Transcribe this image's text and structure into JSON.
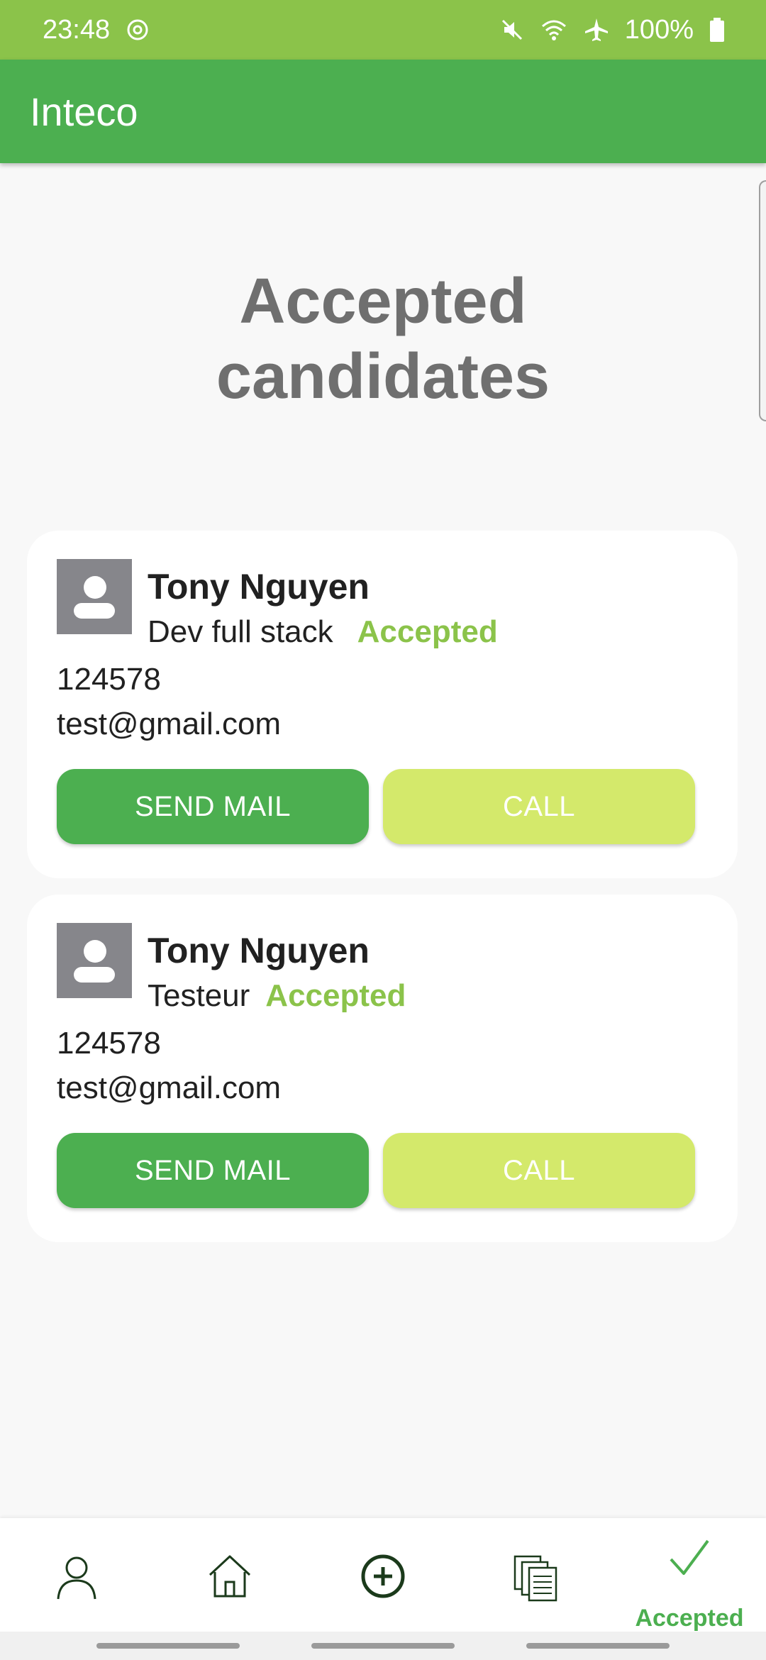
{
  "status_bar": {
    "time": "23:48",
    "battery": "100%",
    "icons": [
      "sync-icon",
      "mute-icon",
      "wifi-icon",
      "airplane-icon",
      "battery-icon"
    ]
  },
  "app_bar": {
    "title": "Inteco"
  },
  "page": {
    "title_line1": "Accepted",
    "title_line2": "candidates"
  },
  "candidates": [
    {
      "name": "Tony Nguyen",
      "role": "Dev full stack",
      "status": "Accepted",
      "phone": "124578",
      "email": "test@gmail.com",
      "mail_label": "SEND MAIL",
      "call_label": "CALL"
    },
    {
      "name": "Tony Nguyen",
      "role": "Testeur",
      "status": "Accepted",
      "phone": "124578",
      "email": "test@gmail.com",
      "mail_label": "SEND MAIL",
      "call_label": "CALL"
    }
  ],
  "bottom_nav": {
    "items": [
      {
        "icon": "person-icon",
        "label": ""
      },
      {
        "icon": "home-icon",
        "label": ""
      },
      {
        "icon": "add-circle-icon",
        "label": ""
      },
      {
        "icon": "documents-icon",
        "label": ""
      },
      {
        "icon": "check-icon",
        "label": "Accepted"
      }
    ],
    "active": "Accepted"
  },
  "colors": {
    "status_bar": "#8bc34a",
    "app_bar": "#4caf50",
    "accent": "#8bc34a",
    "mail_button": "#4caf50",
    "call_button": "#d4e96b",
    "title_text": "#6f6f6f"
  }
}
